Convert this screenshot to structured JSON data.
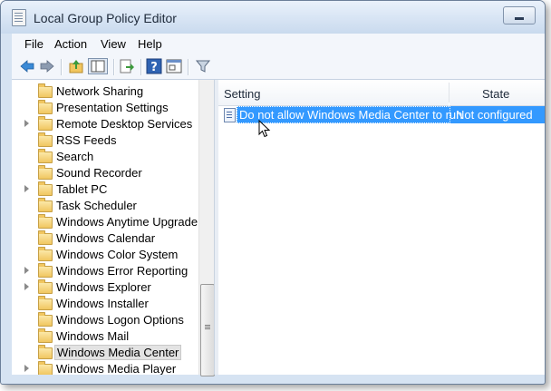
{
  "window": {
    "title": "Local Group Policy Editor"
  },
  "menu": {
    "items": [
      "File",
      "Action",
      "View",
      "Help"
    ]
  },
  "toolbar": {
    "buttons": [
      "back-arrow-icon",
      "forward-arrow-icon",
      "up-folder-icon",
      "show-hide-tree-icon",
      "export-list-icon",
      "help-icon",
      "properties-icon",
      "filter-icon"
    ]
  },
  "tree": {
    "items": [
      {
        "label": "Network Sharing",
        "expandable": false
      },
      {
        "label": "Presentation Settings",
        "expandable": false
      },
      {
        "label": "Remote Desktop Services",
        "expandable": true
      },
      {
        "label": "RSS Feeds",
        "expandable": false
      },
      {
        "label": "Search",
        "expandable": false
      },
      {
        "label": "Sound Recorder",
        "expandable": false
      },
      {
        "label": "Tablet PC",
        "expandable": true
      },
      {
        "label": "Task Scheduler",
        "expandable": false
      },
      {
        "label": "Windows Anytime Upgrade",
        "expandable": false
      },
      {
        "label": "Windows Calendar",
        "expandable": false
      },
      {
        "label": "Windows Color System",
        "expandable": false
      },
      {
        "label": "Windows Error Reporting",
        "expandable": true
      },
      {
        "label": "Windows Explorer",
        "expandable": true
      },
      {
        "label": "Windows Installer",
        "expandable": false
      },
      {
        "label": "Windows Logon Options",
        "expandable": false
      },
      {
        "label": "Windows Mail",
        "expandable": false
      },
      {
        "label": "Windows Media Center",
        "expandable": false,
        "selected": true
      },
      {
        "label": "Windows Media Player",
        "expandable": true
      }
    ]
  },
  "list": {
    "columns": [
      "Setting",
      "State"
    ],
    "rows": [
      {
        "setting": "Do not allow Windows Media Center to run",
        "state": "Not configured",
        "selected": true
      }
    ]
  },
  "colors": {
    "selection": "#3399ff",
    "frame": "#d6e3f2"
  }
}
